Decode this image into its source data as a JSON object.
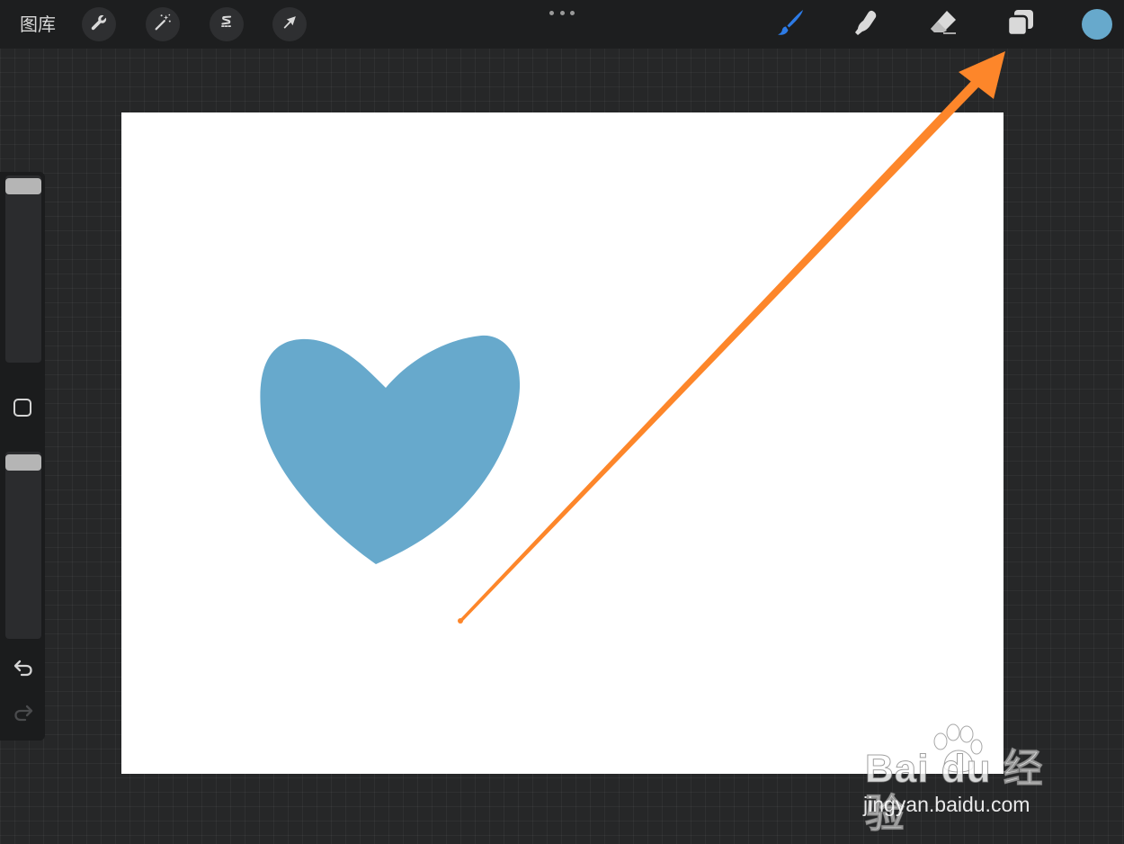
{
  "topbar": {
    "gallery_label": "图库",
    "left_tools": [
      {
        "name": "actions",
        "icon": "wrench-icon"
      },
      {
        "name": "adjustments",
        "icon": "magic-wand-icon"
      },
      {
        "name": "selection",
        "icon": "s-selection-icon"
      },
      {
        "name": "transform",
        "icon": "arrow-cursor-icon"
      }
    ],
    "more_icon": "more-dots-icon",
    "right_tools": [
      {
        "name": "brush",
        "icon": "brush-icon",
        "active": true
      },
      {
        "name": "smudge",
        "icon": "smudge-finger-icon",
        "active": false
      },
      {
        "name": "eraser",
        "icon": "eraser-icon",
        "active": false
      },
      {
        "name": "layers",
        "icon": "layers-icon",
        "active": false
      }
    ],
    "current_color": "#67a9cc"
  },
  "sidebar": {
    "brush_size_level": 1.0,
    "opacity_level": 1.0,
    "modify_icon": "square-icon",
    "undo_icon": "undo-icon",
    "redo_icon": "redo-icon"
  },
  "canvas": {
    "background": "#ffffff",
    "shape_color": "#67a9cc"
  },
  "annotation": {
    "arrow_color": "#fd862a"
  },
  "watermark": {
    "brand": "Bai du 经验",
    "url": "jingyan.baidu.com"
  },
  "colors": {
    "active_tool": "#2d7be6",
    "icon_light": "#d9d9d9"
  }
}
